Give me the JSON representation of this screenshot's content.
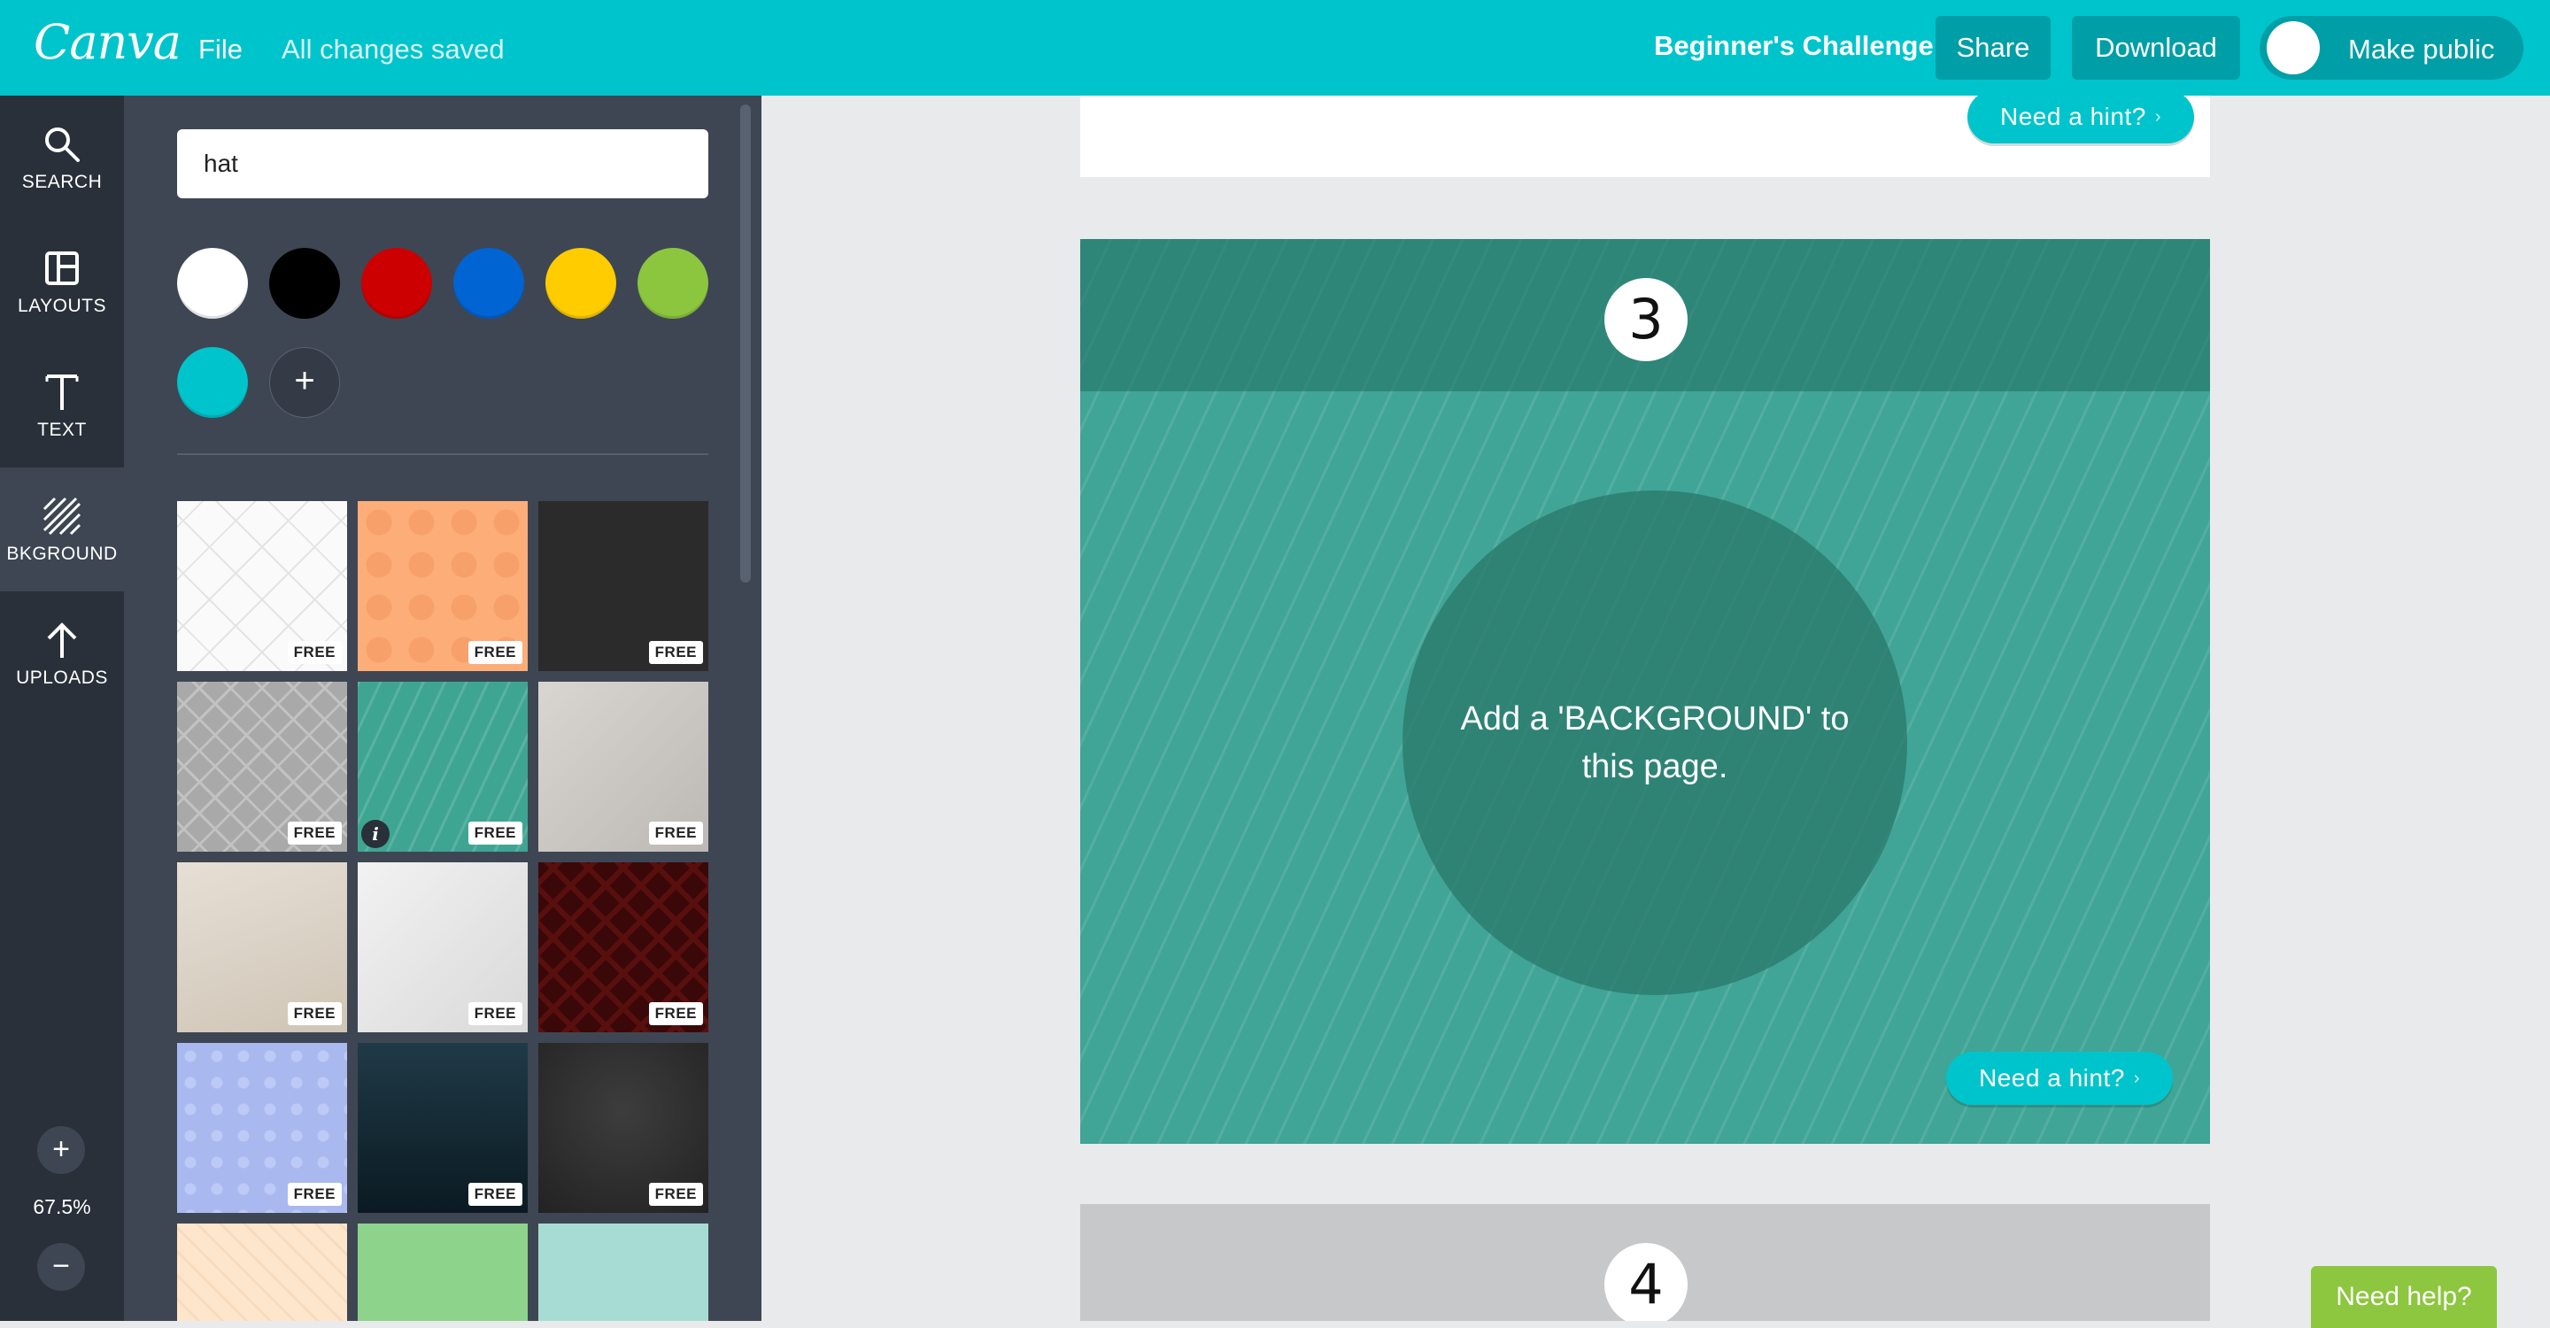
{
  "topbar": {
    "logo": "Canva",
    "file_label": "File",
    "save_status": "All changes saved",
    "design_title": "Beginner's Challenge",
    "share_label": "Share",
    "download_label": "Download",
    "make_public_label": "Make public",
    "accent_color": "#00c4cc"
  },
  "rail": {
    "items": [
      {
        "label": "SEARCH",
        "icon": "search-icon"
      },
      {
        "label": "LAYOUTS",
        "icon": "layouts-icon"
      },
      {
        "label": "TEXT",
        "icon": "text-icon"
      },
      {
        "label": "BKGROUND",
        "icon": "background-icon"
      },
      {
        "label": "UPLOADS",
        "icon": "upload-icon"
      }
    ],
    "active": "BKGROUND",
    "zoom_in": "+",
    "zoom_out": "−",
    "zoom_level": "67.5%"
  },
  "panel": {
    "search_value": "hat",
    "colors": [
      "#ffffff",
      "#000000",
      "#cc0000",
      "#0064d2",
      "#ffcc00",
      "#8cc63f",
      "#00c4cc"
    ],
    "add_color": "+",
    "free_label": "FREE",
    "info_label": "i"
  },
  "canvas": {
    "hint_label": "Need a hint?",
    "page3_number": "3",
    "page3_message": "Add a 'BACKGROUND' to this page.",
    "page4_number": "4"
  },
  "help": {
    "label": "Need help?"
  }
}
